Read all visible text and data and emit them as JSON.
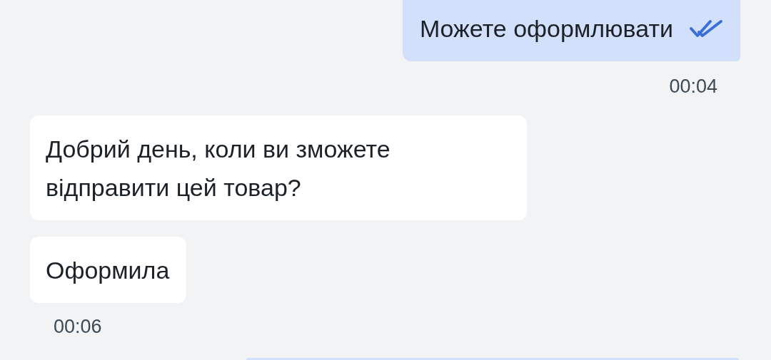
{
  "messages": [
    {
      "kind": "outgoing",
      "text": "Можете оформлювати",
      "read": true,
      "time": "00:04"
    },
    {
      "kind": "incoming",
      "text": "Добрий день, коли ви зможете відправити цей товар?"
    },
    {
      "kind": "incoming",
      "text": "Оформила",
      "time": "00:06"
    }
  ]
}
